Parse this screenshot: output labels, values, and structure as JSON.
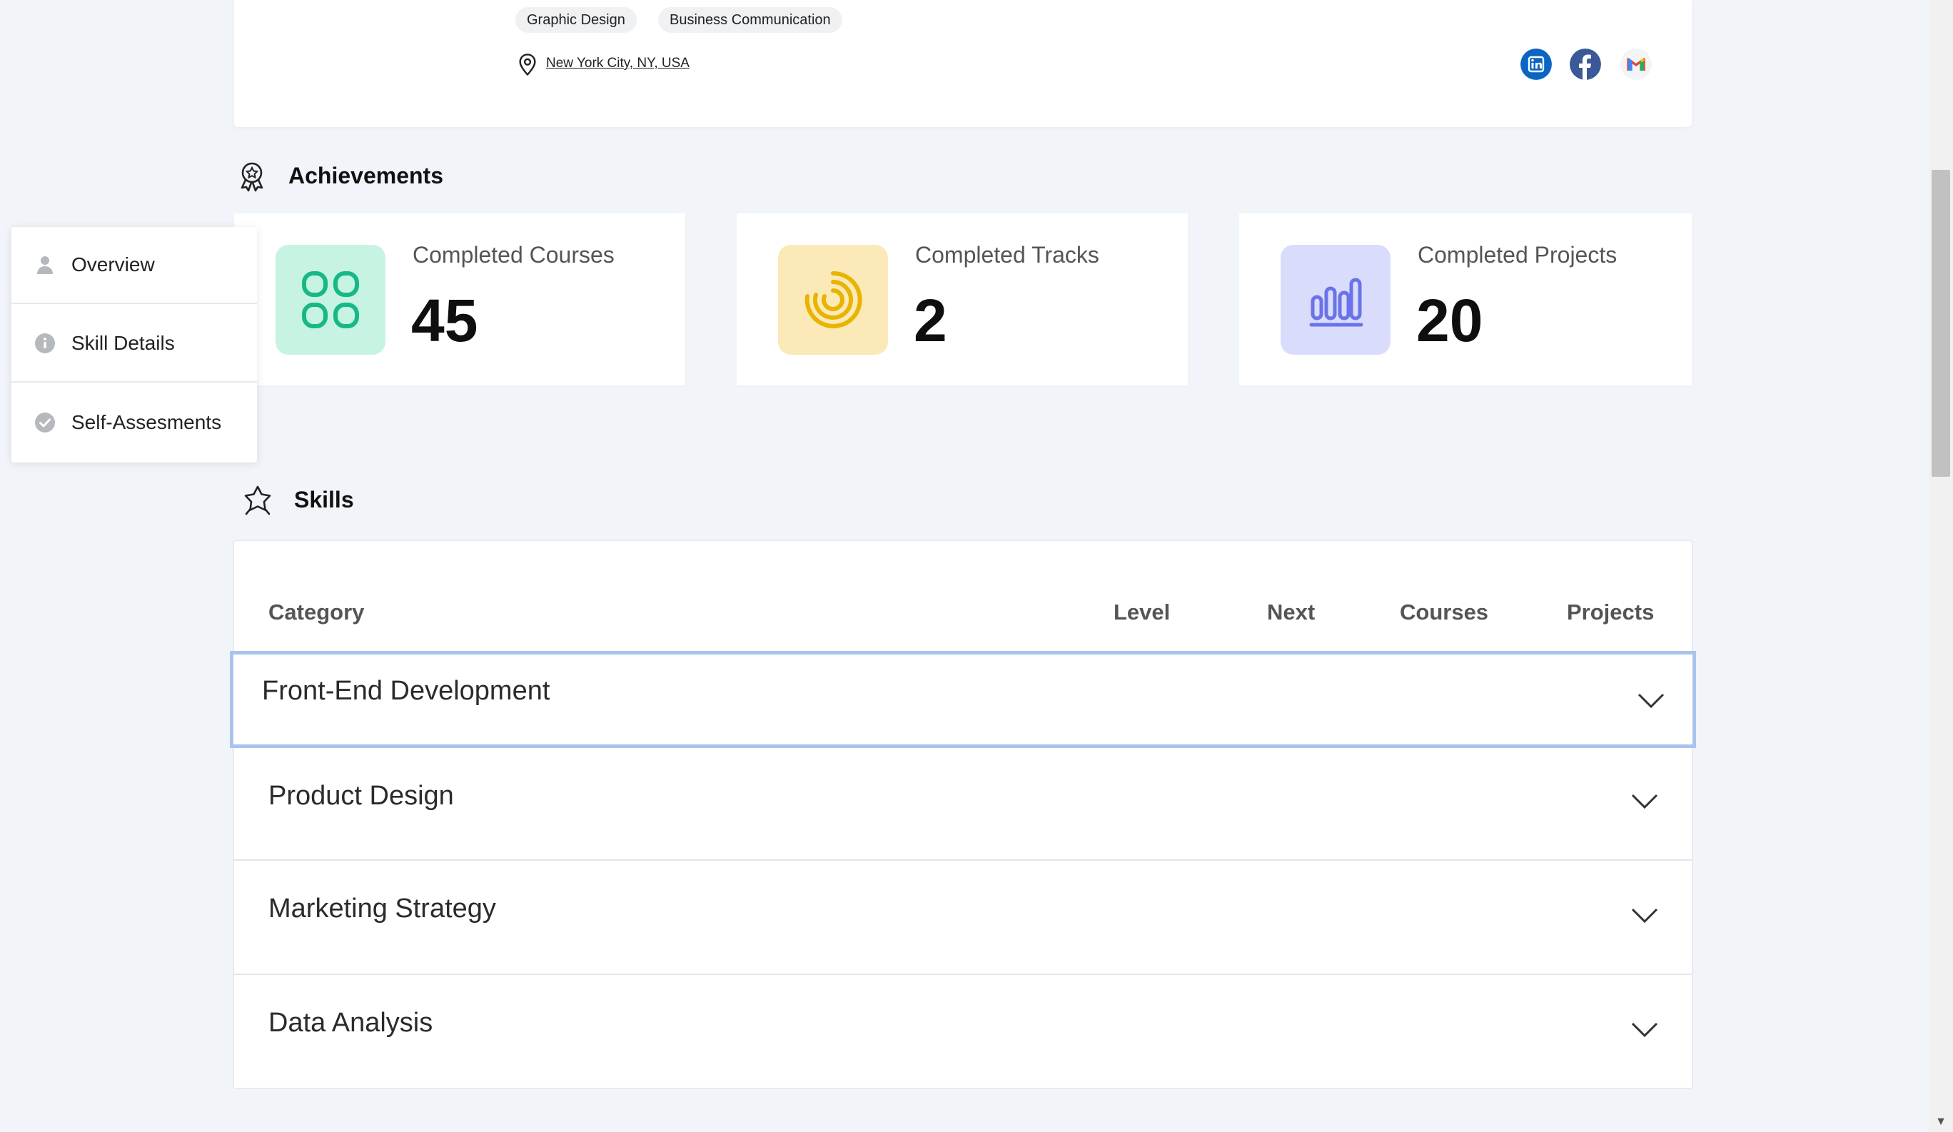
{
  "profile": {
    "tags": [
      "Graphic Design",
      "Business Communication"
    ],
    "location": "New York City, NY, USA",
    "socials": [
      {
        "icon": "linkedin-icon",
        "color": "#0a66c2"
      },
      {
        "icon": "facebook-icon",
        "color": "#3b5998"
      },
      {
        "icon": "gmail-icon",
        "color": "#ea4335"
      }
    ]
  },
  "achievements": {
    "title": "Achievements",
    "cards": [
      {
        "label": "Completed Courses",
        "value": "45",
        "icon": "apps-grid-icon",
        "bg": "#c7f3e2",
        "fg": "#16b886"
      },
      {
        "label": "Completed Tracks",
        "value": "2",
        "icon": "spiral-progress-icon",
        "bg": "#fbeab8",
        "fg": "#e8b400"
      },
      {
        "label": "Completed Projects",
        "value": "20",
        "icon": "bar-chart-icon",
        "bg": "#d9dcfb",
        "fg": "#6b73e8"
      }
    ]
  },
  "side_nav": {
    "items": [
      {
        "label": "Overview",
        "icon": "user-icon"
      },
      {
        "label": "Skill Details",
        "icon": "info-icon"
      },
      {
        "label": "Self-Assesments",
        "icon": "check-circle-icon"
      }
    ]
  },
  "skills": {
    "title": "Skills",
    "columns": {
      "category": "Category",
      "level": "Level",
      "next": "Next",
      "courses": "Courses",
      "projects": "Projects"
    },
    "rows": [
      {
        "name": "Front-End Development",
        "expanded": false,
        "focused": true
      },
      {
        "name": "Product Design",
        "expanded": false,
        "focused": false
      },
      {
        "name": "Marketing Strategy",
        "expanded": false,
        "focused": false
      },
      {
        "name": "Data Analysis",
        "expanded": false,
        "focused": false
      }
    ]
  }
}
